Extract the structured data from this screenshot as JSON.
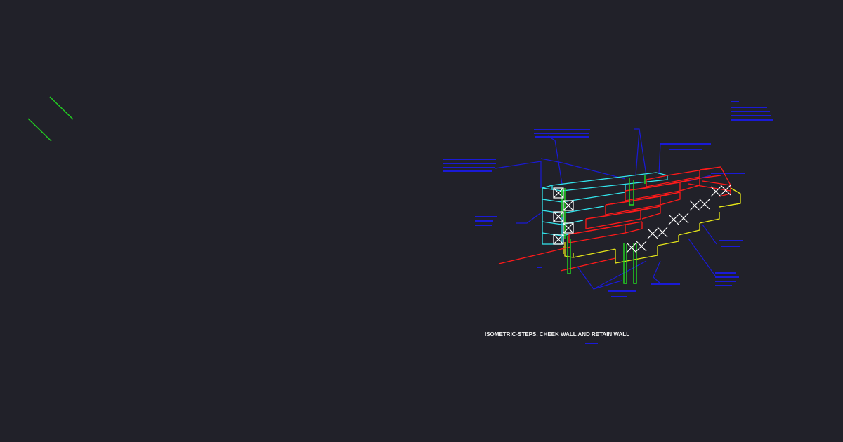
{
  "drawing": {
    "title": "ISOMETRIC-STEPS, CHEEK WALL AND RETAIN WALL",
    "subtitle": "",
    "colors": {
      "background": "#212129",
      "title": "#f2f2f2",
      "annotation": "#1a1ad6",
      "steps": "#ff1a1a",
      "footing": "#e6e619",
      "retain_wall": "#33e6ee",
      "rebar": "#22dd22",
      "block_mark": "#ffffff",
      "stray_lines": "#22cc22"
    }
  }
}
